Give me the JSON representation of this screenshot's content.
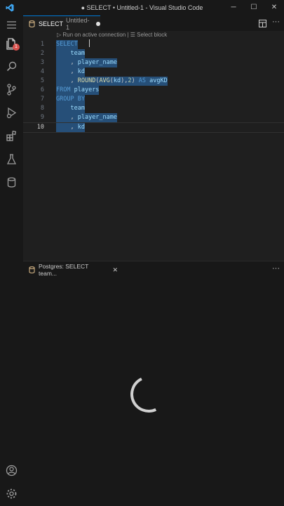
{
  "window": {
    "title": "● SELECT • Untitled-1 - Visual Studio Code"
  },
  "activity_bar": {
    "explorer_badge": "1",
    "items": [
      "explorer-icon",
      "search-icon",
      "source-control-icon",
      "run-debug-icon",
      "extensions-icon",
      "testing-icon",
      "database-icon",
      "account-icon",
      "settings-gear-icon"
    ]
  },
  "tab": {
    "title": "SELECT",
    "subtitle": "Untitled-1"
  },
  "codelens": {
    "run_label": "▷ Run on active connection",
    "separator": "|",
    "select_label": "☰ Select block"
  },
  "editor": {
    "lines": [
      {
        "num": "1",
        "tokens": [
          {
            "t": "SELECT",
            "c": "kw"
          }
        ]
      },
      {
        "num": "2",
        "tokens": [
          {
            "t": "    team",
            "c": "id"
          }
        ]
      },
      {
        "num": "3",
        "tokens": [
          {
            "t": "    , ",
            "c": "pl"
          },
          {
            "t": "player_name",
            "c": "id"
          }
        ]
      },
      {
        "num": "4",
        "tokens": [
          {
            "t": "    , ",
            "c": "pl"
          },
          {
            "t": "kd",
            "c": "id"
          }
        ]
      },
      {
        "num": "5",
        "tokens": [
          {
            "t": "    , ",
            "c": "pl"
          },
          {
            "t": "ROUND",
            "c": "fn"
          },
          {
            "t": "(",
            "c": "pl"
          },
          {
            "t": "AVG",
            "c": "fn"
          },
          {
            "t": "(",
            "c": "pl"
          },
          {
            "t": "kd",
            "c": "id"
          },
          {
            "t": "),",
            "c": "pl"
          },
          {
            "t": "2",
            "c": "num"
          },
          {
            "t": ") ",
            "c": "pl"
          },
          {
            "t": "AS",
            "c": "kw"
          },
          {
            "t": " avgKD",
            "c": "id"
          }
        ]
      },
      {
        "num": "6",
        "tokens": [
          {
            "t": "FROM",
            "c": "kw"
          },
          {
            "t": " players",
            "c": "id"
          }
        ]
      },
      {
        "num": "7",
        "tokens": [
          {
            "t": "GROUP BY",
            "c": "kw"
          }
        ]
      },
      {
        "num": "8",
        "tokens": [
          {
            "t": "    team",
            "c": "id"
          }
        ]
      },
      {
        "num": "9",
        "tokens": [
          {
            "t": "    , ",
            "c": "pl"
          },
          {
            "t": "player_name",
            "c": "id"
          }
        ]
      },
      {
        "num": "10",
        "tokens": [
          {
            "t": "    , ",
            "c": "pl"
          },
          {
            "t": "kd",
            "c": "id"
          }
        ]
      }
    ]
  },
  "panel": {
    "tab_label": "Postgres: SELECT team...",
    "more_label": "···"
  },
  "colors": {
    "accent": "#0078d4",
    "keyword": "#569cd6",
    "function": "#dcdcaa",
    "identifier": "#9cdcfe",
    "number": "#b5cea8",
    "selection": "#264f78",
    "badge": "#d9534f"
  }
}
